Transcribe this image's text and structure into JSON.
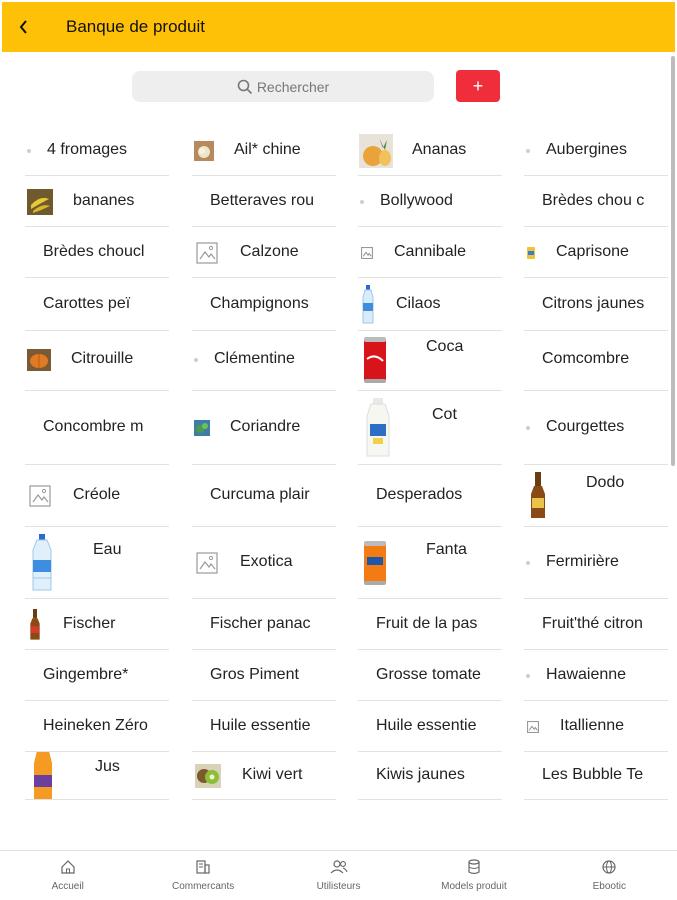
{
  "colors": {
    "header": "#FFC107",
    "add_button": "#EF2D3B",
    "search_bg": "#EEEEEE",
    "scrollbar": "#BDBDBD"
  },
  "header": {
    "title": "Banque de produit",
    "back_icon": "chevron-left-icon"
  },
  "search": {
    "placeholder": "Rechercher",
    "add_label": "+"
  },
  "products": [
    {
      "label": "4 fromages",
      "thumb": "dot"
    },
    {
      "label": "Ail* chine",
      "thumb": "garlic-photo"
    },
    {
      "label": "Ananas",
      "thumb": "pineapple-photo"
    },
    {
      "label": "Aubergines",
      "thumb": "dot"
    },
    {
      "label": "bananes",
      "thumb": "banana-photo"
    },
    {
      "label": "Betteraves rou",
      "thumb": "none"
    },
    {
      "label": "Bollywood",
      "thumb": "dot"
    },
    {
      "label": "Brèdes chou c",
      "thumb": "none"
    },
    {
      "label": "Brèdes choucl",
      "thumb": "none"
    },
    {
      "label": "Calzone",
      "thumb": "placeholder"
    },
    {
      "label": "Cannibale",
      "thumb": "placeholder-small"
    },
    {
      "label": "Caprisone",
      "thumb": "caprisone-photo"
    },
    {
      "label": "Carottes peï",
      "thumb": "none"
    },
    {
      "label": "Champignons",
      "thumb": "none"
    },
    {
      "label": "Cilaos",
      "thumb": "water-bottle-small"
    },
    {
      "label": "Citrons jaunes",
      "thumb": "none"
    },
    {
      "label": "Citrouille",
      "thumb": "pumpkin-photo"
    },
    {
      "label": "Clémentine",
      "thumb": "dot"
    },
    {
      "label": "Coca",
      "thumb": "coca-can"
    },
    {
      "label": "Comcombre",
      "thumb": "none"
    },
    {
      "label": "Concombre m",
      "thumb": "none"
    },
    {
      "label": "Coriandre",
      "thumb": "coriander-photo"
    },
    {
      "label": "Cot",
      "thumb": "milk-bottle"
    },
    {
      "label": "Courgettes",
      "thumb": "dot"
    },
    {
      "label": "Créole",
      "thumb": "placeholder"
    },
    {
      "label": "Curcuma plair",
      "thumb": "none"
    },
    {
      "label": "Desperados",
      "thumb": "none"
    },
    {
      "label": "Dodo",
      "thumb": "beer-bottle"
    },
    {
      "label": "Eau",
      "thumb": "water-bottle"
    },
    {
      "label": "Exotica",
      "thumb": "placeholder"
    },
    {
      "label": "Fanta",
      "thumb": "fanta-can"
    },
    {
      "label": "Fermirière",
      "thumb": "dot"
    },
    {
      "label": "Fischer",
      "thumb": "beer-bottle-small"
    },
    {
      "label": "Fischer panac",
      "thumb": "none"
    },
    {
      "label": "Fruit de la pas",
      "thumb": "none"
    },
    {
      "label": "Fruit'thé citron",
      "thumb": "none"
    },
    {
      "label": "Gingembre*",
      "thumb": "none"
    },
    {
      "label": "Gros Piment",
      "thumb": "none"
    },
    {
      "label": "Grosse tomate",
      "thumb": "none"
    },
    {
      "label": "Hawaienne",
      "thumb": "dot"
    },
    {
      "label": "Heineken Zéro",
      "thumb": "none"
    },
    {
      "label": "Huile essentie",
      "thumb": "none"
    },
    {
      "label": "Huile essentie",
      "thumb": "none"
    },
    {
      "label": "Itallienne",
      "thumb": "placeholder-small"
    },
    {
      "label": "Jus",
      "thumb": "juice-bottle"
    },
    {
      "label": "Kiwi vert",
      "thumb": "kiwi-photo"
    },
    {
      "label": "Kiwis jaunes",
      "thumb": "none"
    },
    {
      "label": "Les Bubble Te",
      "thumb": "none"
    }
  ],
  "tabs": [
    {
      "label": "Accueil",
      "icon": "home-icon"
    },
    {
      "label": "Commercants",
      "icon": "store-icon"
    },
    {
      "label": "Utilisteurs",
      "icon": "users-icon"
    },
    {
      "label": "Models produit",
      "icon": "database-icon"
    },
    {
      "label": "Ebootic",
      "icon": "globe-icon"
    }
  ]
}
